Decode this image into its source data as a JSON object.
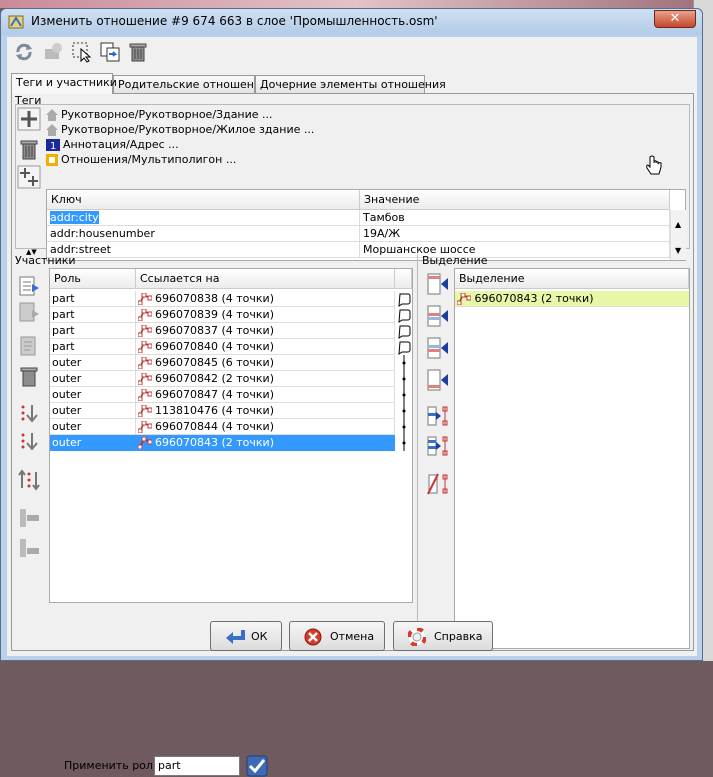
{
  "window": {
    "title": "Изменить отношение #9 674 663 в слое 'Промышленность.osm'"
  },
  "tabs": [
    {
      "label": "Теги и участники"
    },
    {
      "label": "Родительские отношения"
    },
    {
      "label": "Дочерние элементы отношения"
    }
  ],
  "tags": {
    "section_label": "Теги",
    "presets": [
      {
        "label": "Рукотворное/Рукотворное/Здание ...",
        "icon": "house-icon"
      },
      {
        "label": "Рукотворное/Рукотворное/Жилое здание ...",
        "icon": "house-icon"
      },
      {
        "label": "Аннотация/Адрес ...",
        "icon": "address-icon"
      },
      {
        "label": "Отношения/Мультиполигон ...",
        "icon": "multipolygon-icon"
      }
    ],
    "columns": {
      "key": "Ключ",
      "value": "Значение"
    },
    "rows": [
      {
        "key": "addr:city",
        "value": "Тамбов"
      },
      {
        "key": "addr:housenumber",
        "value": "19А/Ж"
      },
      {
        "key": "addr:street",
        "value": "Моршанское шоссе"
      }
    ]
  },
  "members": {
    "section_label": "Участники",
    "columns": {
      "role": "Роль",
      "refers": "Ссылается на"
    },
    "rows": [
      {
        "role": "part",
        "ref": "696070838 (4 точки)"
      },
      {
        "role": "part",
        "ref": "696070839 (4 точки)"
      },
      {
        "role": "part",
        "ref": "696070837 (4 точки)"
      },
      {
        "role": "part",
        "ref": "696070840 (4 точки)"
      },
      {
        "role": "outer",
        "ref": "696070845 (6 точки)"
      },
      {
        "role": "outer",
        "ref": "696070842 (2 точки)"
      },
      {
        "role": "outer",
        "ref": "696070847 (4 точки)"
      },
      {
        "role": "outer",
        "ref": "113810476 (4 точки)"
      },
      {
        "role": "outer",
        "ref": "696070844 (4 точки)"
      },
      {
        "role": "outer",
        "ref": "696070843 (2 точки)"
      }
    ],
    "selected_index": 9,
    "apply_role_label": "Применить роль:",
    "apply_role_value": "part"
  },
  "selection": {
    "section_label": "Выделение",
    "column": "Выделение",
    "rows": [
      {
        "ref": "696070843 (2 точки)"
      }
    ]
  },
  "buttons": {
    "ok": "ОК",
    "cancel": "Отмена",
    "help": "Справка"
  },
  "colors": {
    "selected_row": "#3399ff",
    "selection_highlight": "#e6f7a8",
    "tag_key_selected": "#3399ff"
  }
}
